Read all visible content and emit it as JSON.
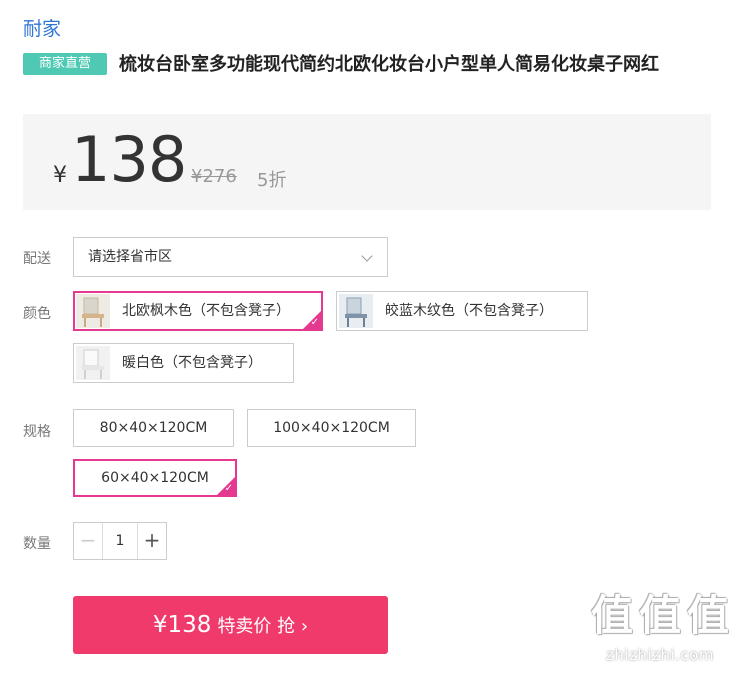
{
  "brand": "耐家",
  "tag": "商家直营",
  "title": "梳妆台卧室多功能现代简约北欧化妆台小户型单人简易化妆桌子网红",
  "price": {
    "currency": "¥",
    "current": "138",
    "original": "¥276",
    "discount": "5折"
  },
  "shipping": {
    "label": "配送",
    "placeholder": "请选择省市区"
  },
  "color": {
    "label": "颜色",
    "options": [
      {
        "label": "北欧枫木色（不包含凳子）",
        "selected": true
      },
      {
        "label": "皎蓝木纹色（不包含凳子）",
        "selected": false
      },
      {
        "label": "暖白色（不包含凳子）",
        "selected": false
      }
    ]
  },
  "spec": {
    "label": "规格",
    "options": [
      {
        "label": "80×40×120CM",
        "selected": false
      },
      {
        "label": "100×40×120CM",
        "selected": false
      },
      {
        "label": "60×40×120CM",
        "selected": true
      }
    ]
  },
  "quantity": {
    "label": "数量",
    "value": "1",
    "minus": "−",
    "plus": "+"
  },
  "buy": {
    "amount": "¥138",
    "text": "特卖价 抢 ›"
  },
  "watermark": {
    "glyph": "值",
    "text": "zhizhizhi.com"
  },
  "colors": {
    "accent_pink": "#e5398f",
    "buy_button": "#f03a6c",
    "brand_blue": "#2f77d6",
    "tag_teal": "#4fc9b3"
  }
}
